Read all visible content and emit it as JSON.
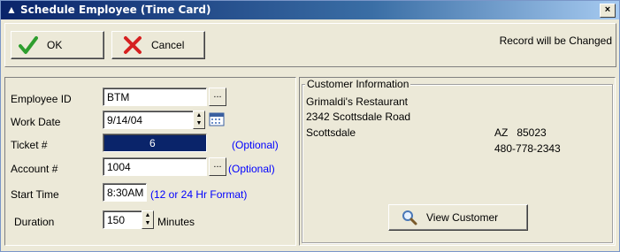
{
  "window": {
    "title": "Schedule Employee (Time Card)",
    "close_symbol": "×"
  },
  "toolbar": {
    "ok_label": "OK",
    "cancel_label": "Cancel",
    "status": "Record will be Changed"
  },
  "form": {
    "employee_id": {
      "label": "Employee ID",
      "value": "BTM"
    },
    "work_date": {
      "label": "Work Date",
      "value": "9/14/04"
    },
    "ticket": {
      "label": "Ticket #",
      "value": "6",
      "hint": "(Optional)"
    },
    "account": {
      "label": "Account #",
      "value": "1004",
      "hint": "(Optional)"
    },
    "start_time": {
      "label": "Start Time",
      "value": "8:30AM",
      "hint": "(12 or 24 Hr Format)"
    },
    "duration": {
      "label": "Duration",
      "value": "150",
      "unit": "Minutes"
    },
    "ellipsis": "..."
  },
  "customer": {
    "group_title": "Customer Information",
    "name": "Grimaldi's Restaurant",
    "address": "2342 Scottsdale Road",
    "city": "Scottsdale",
    "state_zip": "AZ   85023",
    "phone": "480-778-2343",
    "view_button": "View Customer"
  },
  "colors": {
    "accent_blue": "#0000ff",
    "ok_green": "#2e9e2e",
    "cancel_red": "#d62020",
    "title_bar": "#0a246a"
  }
}
